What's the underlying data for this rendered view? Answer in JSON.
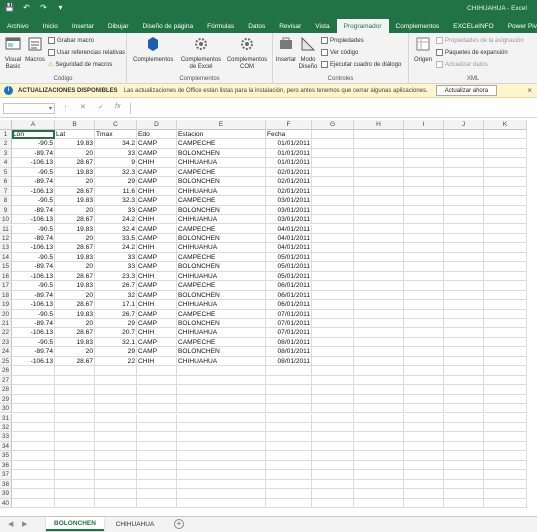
{
  "window": {
    "title": "CHIHUAHUA - Excel"
  },
  "qat": {
    "icons": [
      "save-icon",
      "undo-icon",
      "redo-icon",
      "customize-icon"
    ]
  },
  "tabs": [
    "Archivo",
    "Inicio",
    "Insertar",
    "Dibujar",
    "Diseño de página",
    "Fórmulas",
    "Datos",
    "Revisar",
    "Vista",
    "Programador",
    "Complementos",
    "EXCELeINFO",
    "Power Pivot"
  ],
  "active_tab": "Programador",
  "ribbon": {
    "codigo": {
      "label": "Código",
      "visual_basic": "Visual Basic",
      "macros": "Macros",
      "grabar_macro": "Grabar macro",
      "usar_referencias": "Usar referencias relativas",
      "seguridad": "Seguridad de macros"
    },
    "complementos": {
      "label": "Complementos",
      "complementos": "Complementos",
      "de_excel": "Complementos de Excel",
      "com": "Complementos COM"
    },
    "controles": {
      "label": "Controles",
      "insertar": "Insertar",
      "modo_diseno": "Modo Diseño",
      "propiedades": "Propiedades",
      "ver_codigo": "Ver código",
      "ejecutar_cuadro": "Ejecutar cuadro de diálogo"
    },
    "xml": {
      "label": "XML",
      "origen": "Origen",
      "propiedades_asignacion": "Propiedades de la asignación",
      "paquetes_expansion": "Paquetes de expansión",
      "actualizar_datos": "Actualizar datos"
    }
  },
  "message_bar": {
    "title": "ACTUALIZACIONES DISPONIBLES",
    "text": "Las actualizaciones de Office están listas para la instalación, pero antes tenemos que cerrar algunas aplicaciones.",
    "button": "Actualizar ahora"
  },
  "formula_bar": {
    "name_box": "",
    "cancel": "✕",
    "enter": "✓",
    "fx": "fx",
    "value": ""
  },
  "columns": [
    "A",
    "B",
    "C",
    "D",
    "E",
    "F",
    "G",
    "H",
    "I",
    "J",
    "K"
  ],
  "rows": [
    [
      "Lon",
      "Lat",
      "Tmax",
      "Edo",
      "Estacion",
      "Fecha"
    ],
    [
      "-90.5",
      "19.83",
      "34.2",
      "CAMP",
      "CAMPECHE",
      "01/01/2011"
    ],
    [
      "-89.74",
      "20",
      "33",
      "CAMP",
      "BOLONCHEN",
      "01/01/2011"
    ],
    [
      "-106.13",
      "28.67",
      "9",
      "CHIH",
      "CHIHUAHUA",
      "01/01/2011"
    ],
    [
      "-90.5",
      "19.83",
      "32.3",
      "CAMP",
      "CAMPECHE",
      "02/01/2011"
    ],
    [
      "-89.74",
      "20",
      "29",
      "CAMP",
      "BOLONCHEN",
      "02/01/2011"
    ],
    [
      "-106.13",
      "28.67",
      "11.6",
      "CHIH",
      "CHIHUAHUA",
      "02/01/2011"
    ],
    [
      "-90.5",
      "19.83",
      "32.3",
      "CAMP",
      "CAMPECHE",
      "03/01/2011"
    ],
    [
      "-89.74",
      "20",
      "33",
      "CAMP",
      "BOLONCHEN",
      "03/01/2011"
    ],
    [
      "-106.13",
      "28.67",
      "24.2",
      "CHIH",
      "CHIHUAHUA",
      "03/01/2011"
    ],
    [
      "-90.5",
      "19.83",
      "32.4",
      "CAMP",
      "CAMPECHE",
      "04/01/2011"
    ],
    [
      "-89.74",
      "20",
      "33.5",
      "CAMP",
      "BOLONCHEN",
      "04/01/2011"
    ],
    [
      "-106.13",
      "28.67",
      "24.2",
      "CHIH",
      "CHIHUAHUA",
      "04/01/2011"
    ],
    [
      "-90.5",
      "19.83",
      "33",
      "CAMP",
      "CAMPECHE",
      "05/01/2011"
    ],
    [
      "-89.74",
      "20",
      "33",
      "CAMP",
      "BOLONCHEN",
      "05/01/2011"
    ],
    [
      "-106.13",
      "28.67",
      "23.3",
      "CHIH",
      "CHIHUAHUA",
      "05/01/2011"
    ],
    [
      "-90.5",
      "19.83",
      "26.7",
      "CAMP",
      "CAMPECHE",
      "06/01/2011"
    ],
    [
      "-89.74",
      "20",
      "32",
      "CAMP",
      "BOLONCHEN",
      "06/01/2011"
    ],
    [
      "-106.13",
      "28.67",
      "17.1",
      "CHIH",
      "CHIHUAHUA",
      "06/01/2011"
    ],
    [
      "-90.5",
      "19.83",
      "26.7",
      "CAMP",
      "CAMPECHE",
      "07/01/2011"
    ],
    [
      "-89.74",
      "20",
      "29",
      "CAMP",
      "BOLONCHEN",
      "07/01/2011"
    ],
    [
      "-106.13",
      "28.67",
      "20.7",
      "CHIH",
      "CHIHUAHUA",
      "07/01/2011"
    ],
    [
      "-90.5",
      "19.83",
      "32.1",
      "CAMP",
      "CAMPECHE",
      "08/01/2011"
    ],
    [
      "-89.74",
      "20",
      "29",
      "CAMP",
      "BOLONCHEN",
      "08/01/2011"
    ],
    [
      "-106.13",
      "28.67",
      "22",
      "CHIH",
      "CHIHUAHUA",
      "08/01/2011"
    ]
  ],
  "row_count": 40,
  "sheets": [
    "BOLONCHEN",
    "CHIHUAHUA"
  ],
  "active_sheet": "BOLONCHEN",
  "colors": {
    "accent": "#217346",
    "message_bar": "#fdf5ce"
  }
}
